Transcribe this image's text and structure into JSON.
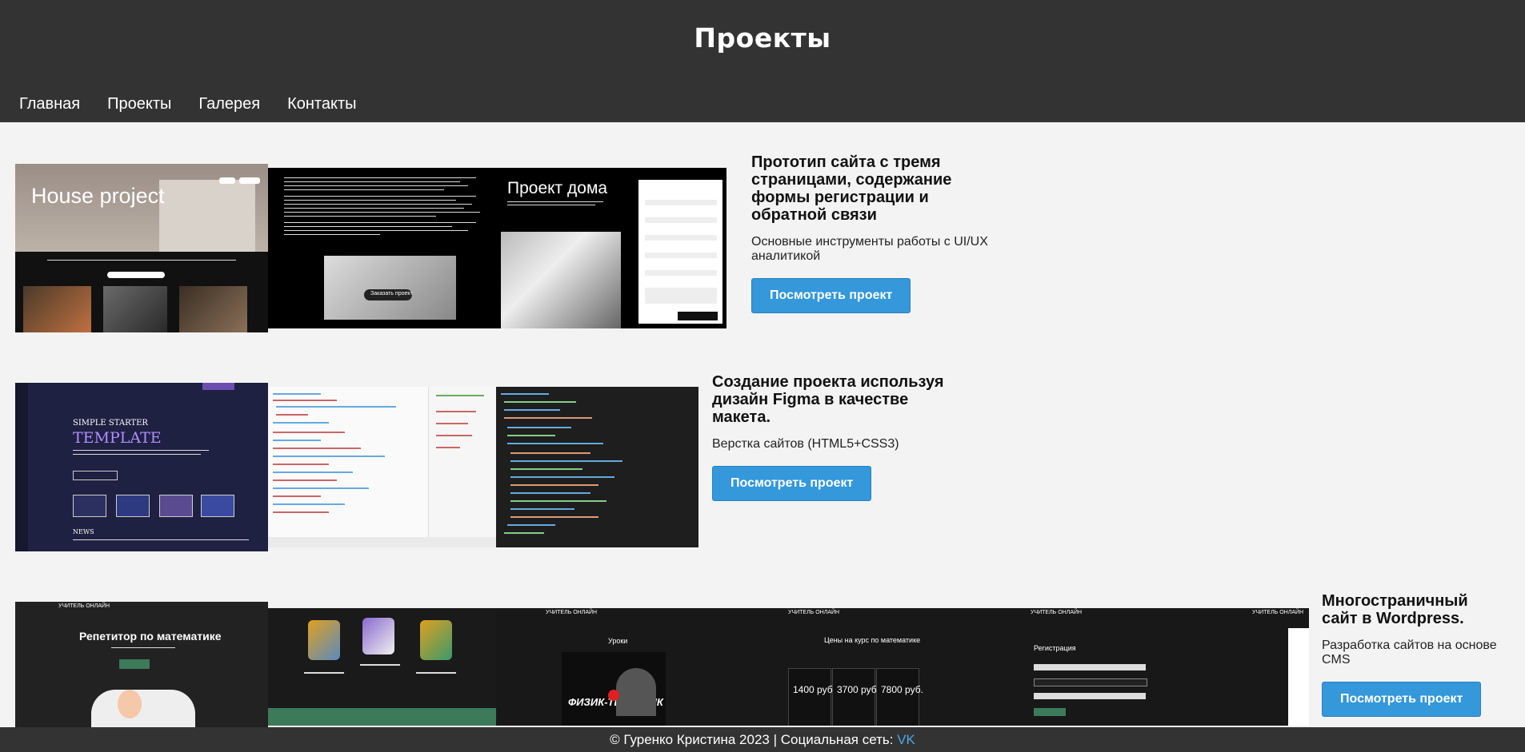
{
  "header": {
    "title": "Проекты",
    "nav": [
      "Главная",
      "Проекты",
      "Галерея",
      "Контакты"
    ]
  },
  "projects": [
    {
      "title": "Прототип сайта с тремя страницами, содержание формы регистрации и обратной связи",
      "description": "Основные инструменты работы с UI/UX аналитикой",
      "button": "Посмотреть проект",
      "thumb_text": {
        "house": "House project",
        "dom": "Проект дома",
        "order": "Заказать проект"
      }
    },
    {
      "title": "Создание проекта используя дизайн Figma в качестве макета.",
      "description": "Верстка сайтов (HTML5+CSS3)",
      "button": "Посмотреть проект",
      "thumb_text": {
        "simple": "SIMPLE STARTER",
        "template": "TEMPLATE",
        "news": "NEWS"
      }
    },
    {
      "title": "Многостраничный сайт в Wordpress.",
      "description": "Разработка сайтов на основе CMS",
      "button": "Посмотреть проект",
      "thumb_text": {
        "tutor": "Репетитор по математике",
        "teacher": "УЧИТЕЛЬ ОНЛАЙН",
        "lessons": "Уроки",
        "prices": "Цены на курс по математике",
        "price1": "1400 руб.",
        "price2": "3700 руб.",
        "price3": "7800 руб.",
        "register": "Регистрация",
        "physicist": "ФИЗИК-ТЕОРЕТИК"
      }
    }
  ],
  "footer": {
    "text": "© Гуренко Кристина 2023 | Социальная сеть: ",
    "link": "VK"
  }
}
